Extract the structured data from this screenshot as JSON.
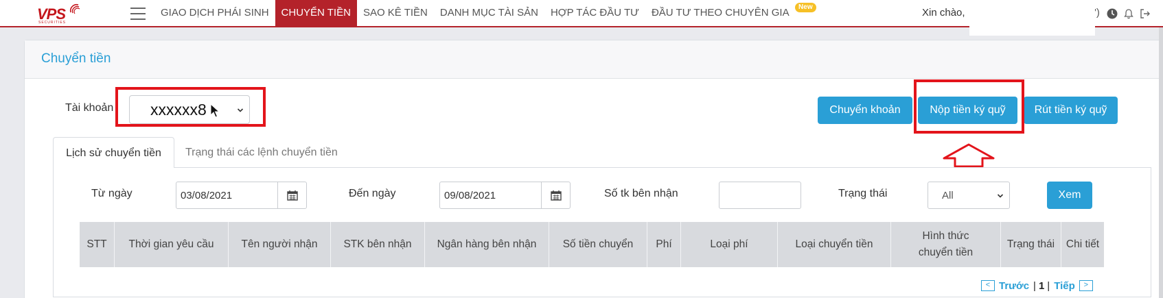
{
  "brand": {
    "logo_text": "VPS",
    "logo_sub": "SECURITIES"
  },
  "nav": {
    "items": [
      {
        "label": "GIAO DỊCH PHÁI SINH"
      },
      {
        "label": "CHUYỂN TIỀN"
      },
      {
        "label": "SAO KÊ TIỀN"
      },
      {
        "label": "DANH MỤC TÀI SẢN"
      },
      {
        "label": "HỢP TÁC ĐẦU TƯ"
      },
      {
        "label": "ĐẦU TƯ THEO CHUYÊN GIA"
      }
    ],
    "new_badge": "New",
    "active_index": 1
  },
  "user": {
    "greeting": "Xin chào,",
    "paren_close": "')"
  },
  "page": {
    "title": "Chuyển tiền"
  },
  "account": {
    "label": "Tài khoản",
    "value": "xxxxxx8"
  },
  "actions": {
    "transfer": "Chuyển khoản",
    "deposit_margin": "Nộp tiền ký quỹ",
    "withdraw_margin": "Rút tiền ký quỹ"
  },
  "tabs": [
    {
      "label": "Lịch sử chuyển tiền"
    },
    {
      "label": "Trạng thái các lệnh chuyển tiền"
    }
  ],
  "filters": {
    "from_label": "Từ ngày",
    "from_value": "03/08/2021",
    "to_label": "Đến ngày",
    "to_value": "09/08/2021",
    "recipient_acc_label": "Số tk bên nhận",
    "recipient_acc_value": "",
    "status_label": "Trạng thái",
    "status_value": "All",
    "submit": "Xem"
  },
  "table": {
    "columns": [
      "STT",
      "Thời gian yêu cầu",
      "Tên người nhận",
      "STK bên nhận",
      "Ngân hàng bên nhận",
      "Số tiền chuyển",
      "Phí",
      "Loại phí",
      "Loại chuyển tiền",
      "Hình thức chuyển tiền",
      "Trạng thái",
      "Chi tiết"
    ]
  },
  "pagination": {
    "prev_label": "Trước",
    "current": "1",
    "next_label": "Tiếp",
    "prev_icon": "<",
    "next_icon": ">",
    "sep": "|"
  },
  "colors": {
    "brand_red": "#b4222a",
    "accent_blue": "#2a9fd6",
    "annotation_red": "#e3141b"
  }
}
